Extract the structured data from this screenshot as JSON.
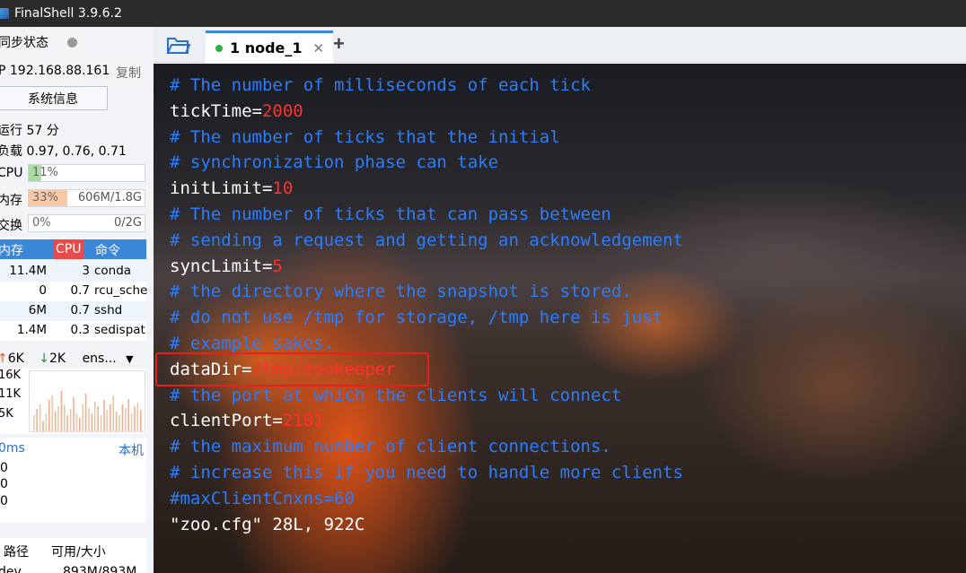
{
  "window": {
    "title": "FinalShell 3.9.6.2"
  },
  "sidebar": {
    "sync_status": "同步状态",
    "ip": "P 192.168.88.161",
    "copy": "复制",
    "sysinfo_button": "系统信息",
    "uptime": "运行 57 分",
    "load": "负载 0.97, 0.76, 0.71",
    "cpu": {
      "label": "CPU",
      "percent": "11%",
      "fill": 0.11
    },
    "mem": {
      "label": "内存",
      "percent": "33%",
      "detail": "606M/1.8G",
      "fill": 0.33
    },
    "swap": {
      "label": "交换",
      "percent": "0%",
      "detail": "0/2G",
      "fill": 0
    },
    "process_headers": [
      "内存",
      "CPU",
      "命令"
    ],
    "processes": [
      {
        "mem": "11.4M",
        "cpu": "3",
        "cmd": "conda"
      },
      {
        "mem": "0",
        "cpu": "0.7",
        "cmd": "rcu_sche"
      },
      {
        "mem": "6M",
        "cpu": "0.7",
        "cmd": "sshd"
      },
      {
        "mem": "1.4M",
        "cpu": "0.3",
        "cmd": "sedispat"
      }
    ],
    "net": {
      "up": "6K",
      "down": "2K",
      "iface": "ens..."
    },
    "chart_labels": [
      "16K",
      "11K",
      "5K"
    ],
    "ping": {
      "label": "0ms",
      "host": "本机",
      "rows": [
        "0",
        "0",
        "0"
      ]
    },
    "disk_headers": [
      "路径",
      "可用/大小"
    ],
    "disk_row": {
      "path": "dev",
      "size": "893M/893M"
    }
  },
  "tabs": {
    "active_label": "1 node_1"
  },
  "terminal": {
    "lines": [
      [
        {
          "t": "# The number of milliseconds of each tick",
          "c": "cm"
        }
      ],
      [
        {
          "t": "tickTime=",
          "c": "kw"
        },
        {
          "t": "2000",
          "c": "vl"
        }
      ],
      [
        {
          "t": "# The number of ticks that the initial",
          "c": "cm"
        }
      ],
      [
        {
          "t": "# synchronization phase can take",
          "c": "cm"
        }
      ],
      [
        {
          "t": "initLimit=",
          "c": "kw"
        },
        {
          "t": "10",
          "c": "vl"
        }
      ],
      [
        {
          "t": "# The number of ticks that can pass between",
          "c": "cm"
        }
      ],
      [
        {
          "t": "# sending a request and getting an acknowledgement",
          "c": "cm"
        }
      ],
      [
        {
          "t": "syncLimit=",
          "c": "kw"
        },
        {
          "t": "5",
          "c": "vl"
        }
      ],
      [
        {
          "t": "# the directory where the snapshot is stored.",
          "c": "cm"
        }
      ],
      [
        {
          "t": "# do not use /tmp for storage, /tmp here is just",
          "c": "cm"
        }
      ],
      [
        {
          "t": "# example sakes.",
          "c": "cm"
        }
      ],
      [
        {
          "t": "dataDir=",
          "c": "kw"
        },
        {
          "t": "/tmp/zookeeper",
          "c": "vl"
        }
      ],
      [
        {
          "t": "# the port at which the clients will connect",
          "c": "cm"
        }
      ],
      [
        {
          "t": "clientPort=",
          "c": "kw"
        },
        {
          "t": "2181",
          "c": "vl"
        }
      ],
      [
        {
          "t": "# the maximum number of client connections.",
          "c": "cm"
        }
      ],
      [
        {
          "t": "# increase this if you need to handle more clients",
          "c": "cm"
        }
      ],
      [
        {
          "t": "#maxClientCnxns=60",
          "c": "cm"
        }
      ],
      [
        {
          "t": "\"zoo.cfg\" 28L, 922C",
          "c": "kw"
        }
      ]
    ]
  },
  "colors": {
    "accent": "#3a87d8",
    "comment": "#2a7dff",
    "value": "#ff3030",
    "highlight": "#e8201c"
  }
}
